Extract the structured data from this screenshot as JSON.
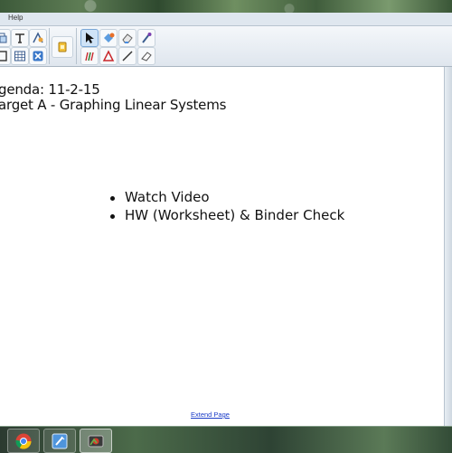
{
  "menubar": {
    "help_label": "Help"
  },
  "toolbar": {
    "left_group": [
      "copy-icon",
      "text-tool-icon",
      "shape-recognizer-icon",
      "frame-icon",
      "table-icon",
      "delete-icon"
    ],
    "middle_group": [
      "screen-shade-icon"
    ],
    "right_group": [
      "select-arrow-icon",
      "fill-icon",
      "eraser-icon",
      "magic-pen-icon",
      "creative-pen-icon",
      "shapes-icon",
      "line-icon",
      "eraser-line-icon"
    ]
  },
  "page": {
    "title_line1": "genda: 11-2-15",
    "title_line2": "arget A - Graphing Linear Systems",
    "bullets": [
      "Watch Video",
      "HW (Worksheet) & Binder Check"
    ],
    "extend_link": "Extend Page"
  },
  "taskbar": {
    "items": [
      "chrome-icon",
      "notebook-icon",
      "notebook-recorder-icon"
    ]
  },
  "colors": {
    "link": "#1a3cc8",
    "text": "#111111",
    "toolbar_bg": "#e8eef4"
  }
}
